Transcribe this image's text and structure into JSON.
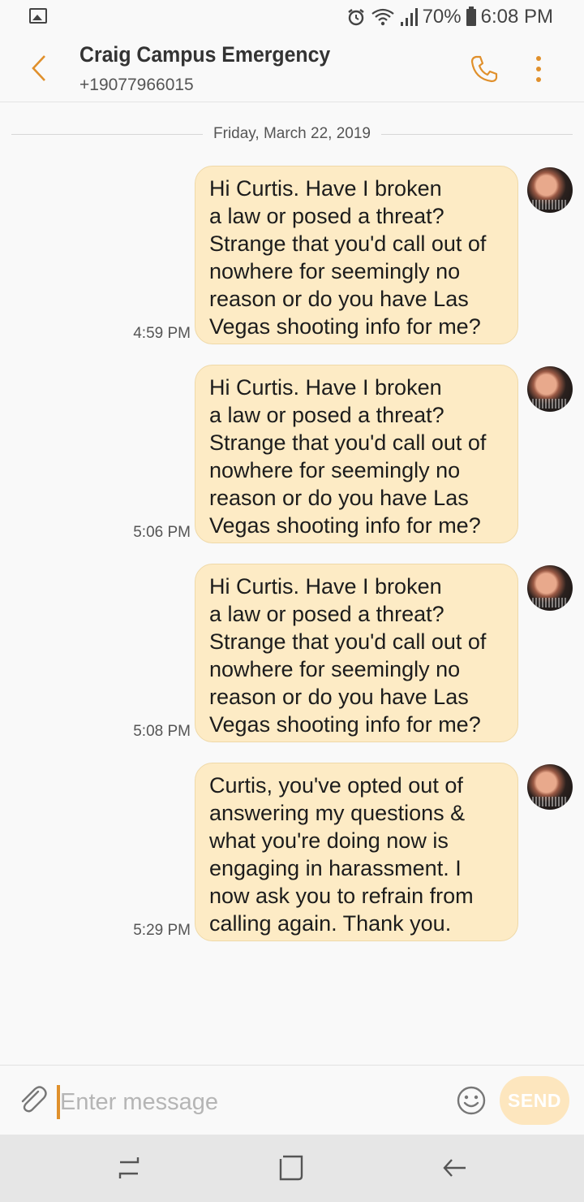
{
  "status_bar": {
    "icons": [
      "gallery-icon",
      "alarm-icon",
      "wifi-icon",
      "signal-icon",
      "battery-icon"
    ],
    "battery": "70%",
    "time": "6:08 PM"
  },
  "header": {
    "contact_name": "Craig Campus Emergency",
    "contact_number": "+19077966015",
    "icons": [
      "back-arrow-icon",
      "phone-icon",
      "more-vert-icon"
    ]
  },
  "date_divider": "Friday, March 22, 2019",
  "messages": [
    {
      "lines": [
        "Hi Curtis. Have I broken",
        "a law or posed a threat?",
        "Strange that you'd call out of",
        "nowhere for seemingly no",
        "reason or do you have Las",
        "Vegas shooting info for me?"
      ],
      "time": "4:59 PM"
    },
    {
      "lines": [
        "Hi Curtis. Have I broken",
        "a law or posed a threat?",
        "Strange that you'd call out of",
        "nowhere for seemingly no",
        "reason or do you have Las",
        "Vegas shooting info for me?"
      ],
      "time": "5:06 PM"
    },
    {
      "lines": [
        "Hi Curtis. Have I broken",
        "a law or posed a threat?",
        "Strange that you'd call out of",
        "nowhere for seemingly no",
        "reason or do you have Las",
        "Vegas shooting info for me?"
      ],
      "time": "5:08 PM"
    },
    {
      "lines": [
        "Curtis, you've opted out of",
        "answering my questions &",
        "what you're doing now is",
        "engaging in harassment. I",
        "now ask you to refrain from",
        "calling again. Thank you."
      ],
      "time": "5:29 PM"
    }
  ],
  "composer": {
    "placeholder": "Enter message",
    "value": "",
    "send_label": "SEND",
    "icons": [
      "paperclip-icon",
      "emoji-icon"
    ]
  },
  "nav_bar": {
    "icons": [
      "recent-apps-icon",
      "home-icon",
      "back-icon"
    ]
  },
  "colors": {
    "accent": "#e0902c",
    "bubble": "#fdebc5",
    "send_disabled": "#fde6be",
    "background": "#f9f9f9"
  }
}
